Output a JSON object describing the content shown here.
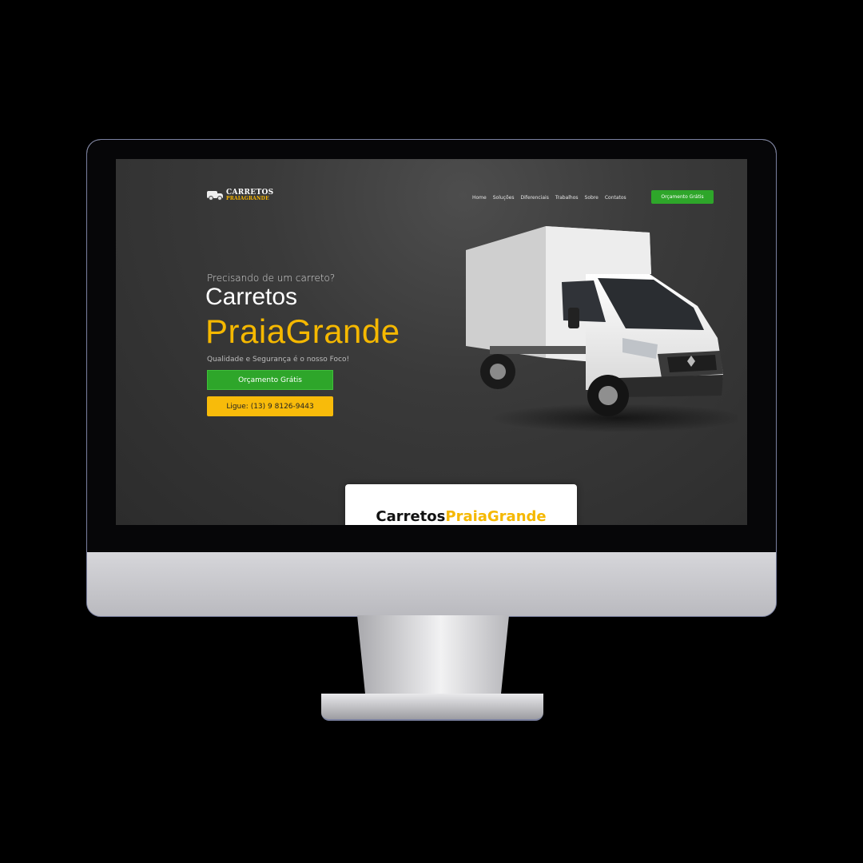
{
  "logo": {
    "top": "CARRETOS",
    "bottom": "PRAIAGRANDE"
  },
  "nav": {
    "items": [
      "Home",
      "Soluções",
      "Diferenciais",
      "Trabalhos",
      "Sobre",
      "Contatos"
    ],
    "cta": "Orçamento Grátis"
  },
  "hero": {
    "eyebrow": "Precisando de um carreto?",
    "title_line1": "Carretos",
    "title_line2": "PraiaGrande",
    "tagline": "Qualidade e Segurança é o nosso Foco!",
    "btn_quote": "Orçamento Grátis",
    "btn_call": "Ligue: (13) 9 8126-9443"
  },
  "card": {
    "title_part1": "Carretos",
    "title_part2": "PraiaGrande"
  },
  "colors": {
    "accent_yellow": "#f5b800",
    "accent_green": "#2ea62a",
    "background": "#333333"
  }
}
